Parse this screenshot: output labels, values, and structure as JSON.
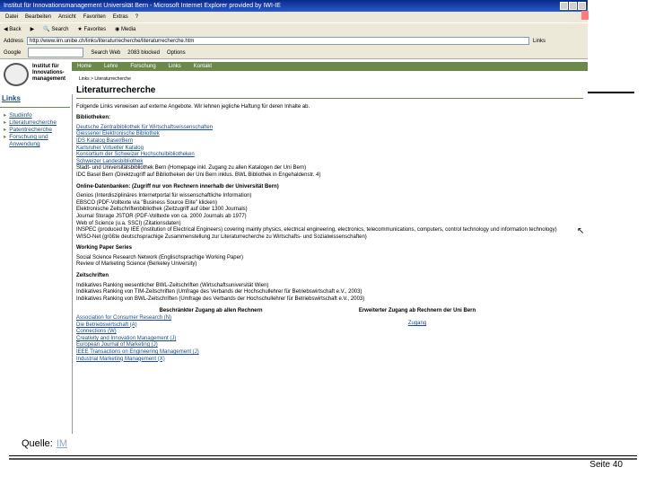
{
  "window": {
    "title": "Institut für Innovationsmanagement Universität Bern - Microsoft Internet Explorer provided by IWI-IE"
  },
  "menu": [
    "Datei",
    "Bearbeiten",
    "Ansicht",
    "Favoriten",
    "Extras",
    "?"
  ],
  "toolbar": {
    "back": "Back",
    "search": "Search",
    "favorites": "Favorites",
    "media": "Media"
  },
  "address": {
    "label": "Address",
    "value": "http://www.iim.unibe.ch/links/literaturrecherche/literaturrecherche.htm",
    "go": "Links"
  },
  "googlebar": {
    "label": "Google",
    "search_web": "Search Web",
    "blocked": "2083 blocked",
    "options": "Options"
  },
  "site": {
    "institute": "Institut für Innovations-management",
    "nav": [
      "Home",
      "Lehre",
      "Forschung",
      "Links",
      "Kontakt"
    ],
    "breadcrumb": "Links > Literaturrecherche"
  },
  "left": {
    "heading": "Links",
    "items": [
      "Studiinfo",
      "Literaturrecherche",
      "Patentrecherche",
      "Forschung und Anwendung"
    ]
  },
  "content": {
    "title": "Literaturrecherche",
    "intro": "Folgende Links verweisen auf externe Angebote. Wir lehnen jegliche Haftung für deren Inhalte ab.",
    "bib_heading": "Bibliotheken:",
    "bib": [
      "Deutsche Zentralbibliothek für Wirtschaftswissenschaften",
      "Giessener Elektronische Bibliothek",
      "IDS Katalog Basel/Bern",
      "Karlsruher Virtueller Katalog",
      "Konsortium der Schweizer Hochschulbibliotheken",
      "Schweizer Landesbibliothek",
      "Stadt- und Universitätsbibliothek Bern (Homepage inkl. Zugang zu allen Katalogen der Uni Bern)",
      "IDC Basel Bern (Direktzugriff auf Bibliotheken der Uni Bern inklus. BWL Bibliothek in Engehaldenstr. 4)"
    ],
    "db_heading": "Online-Datenbanken: (Zugriff nur von Rechnern innerhalb der Universität Bern)",
    "db": [
      "Genios (Interdisziplinäres Internetportal für wissenschaftliche Information)",
      "EBSCO (PDF-Volltexte via \"Business Source Elite\" klicken)",
      "Elektronische Zeitschriftenbibliothek (Zeitzugriff auf über 1300 Journals)",
      "Journal Storage JSTOR (PDF-Volltexte von ca. 2000 Journals ab 1977)",
      "Web of Science (u.a. SSCI) (Zitationsdaten)",
      "INSPEC (produced by IEE (Institution of Electrical Engineers) covering mainly physics, electrical engineering, electronics, telecommunications, computers, control technology und information technology)",
      "WISO-Net (größte deutschsprachige Zusammenstellung zur Literaturrecherche zu Wirtschafts- und Sozialwissenschaften)"
    ],
    "wp_heading": "Working Paper Series",
    "wp": [
      "Social Science Research Network (Englischsprachige Working Paper)",
      "Review of Marketing Science (Berkeley University)"
    ],
    "zs_heading": "Zeitschriften",
    "zs": [
      "Indikatives Ranking wesentlicher BWL-Zeitschriften (Wirtschaftsuniversität Wien)",
      "Indikatives Ranking von TIM-Zeitschriften (Umfrage des Verbands der Hochschullehrer für Betriebswirtschaft e.V., 2003)",
      "Indikatives Ranking von BWL-Zeitschriften (Umfrage des Verbands der Hochschullehrer für Betriebswirtschaft e.V., 2003)"
    ],
    "table": {
      "col1_head": "Beschränkter Zugang ab allen Rechnern",
      "col2_head": "Erweiterter Zugang ab Rechnern der Uni Bern",
      "col1": [
        "Association for Consumer Research (N)",
        "Die Betriebswirtschaft (A)",
        "Connections (W)",
        "Creativity and Innovation Management (J)",
        "European Journal of Marketing (J)",
        "IEEE Transactions on Engineering Management (J)",
        "Industrial Marketing Management (X)"
      ],
      "col2": [
        "Zugang"
      ]
    }
  },
  "footer": {
    "quelle": "Quelle:",
    "source": "IM",
    "page": "Seite 40"
  }
}
